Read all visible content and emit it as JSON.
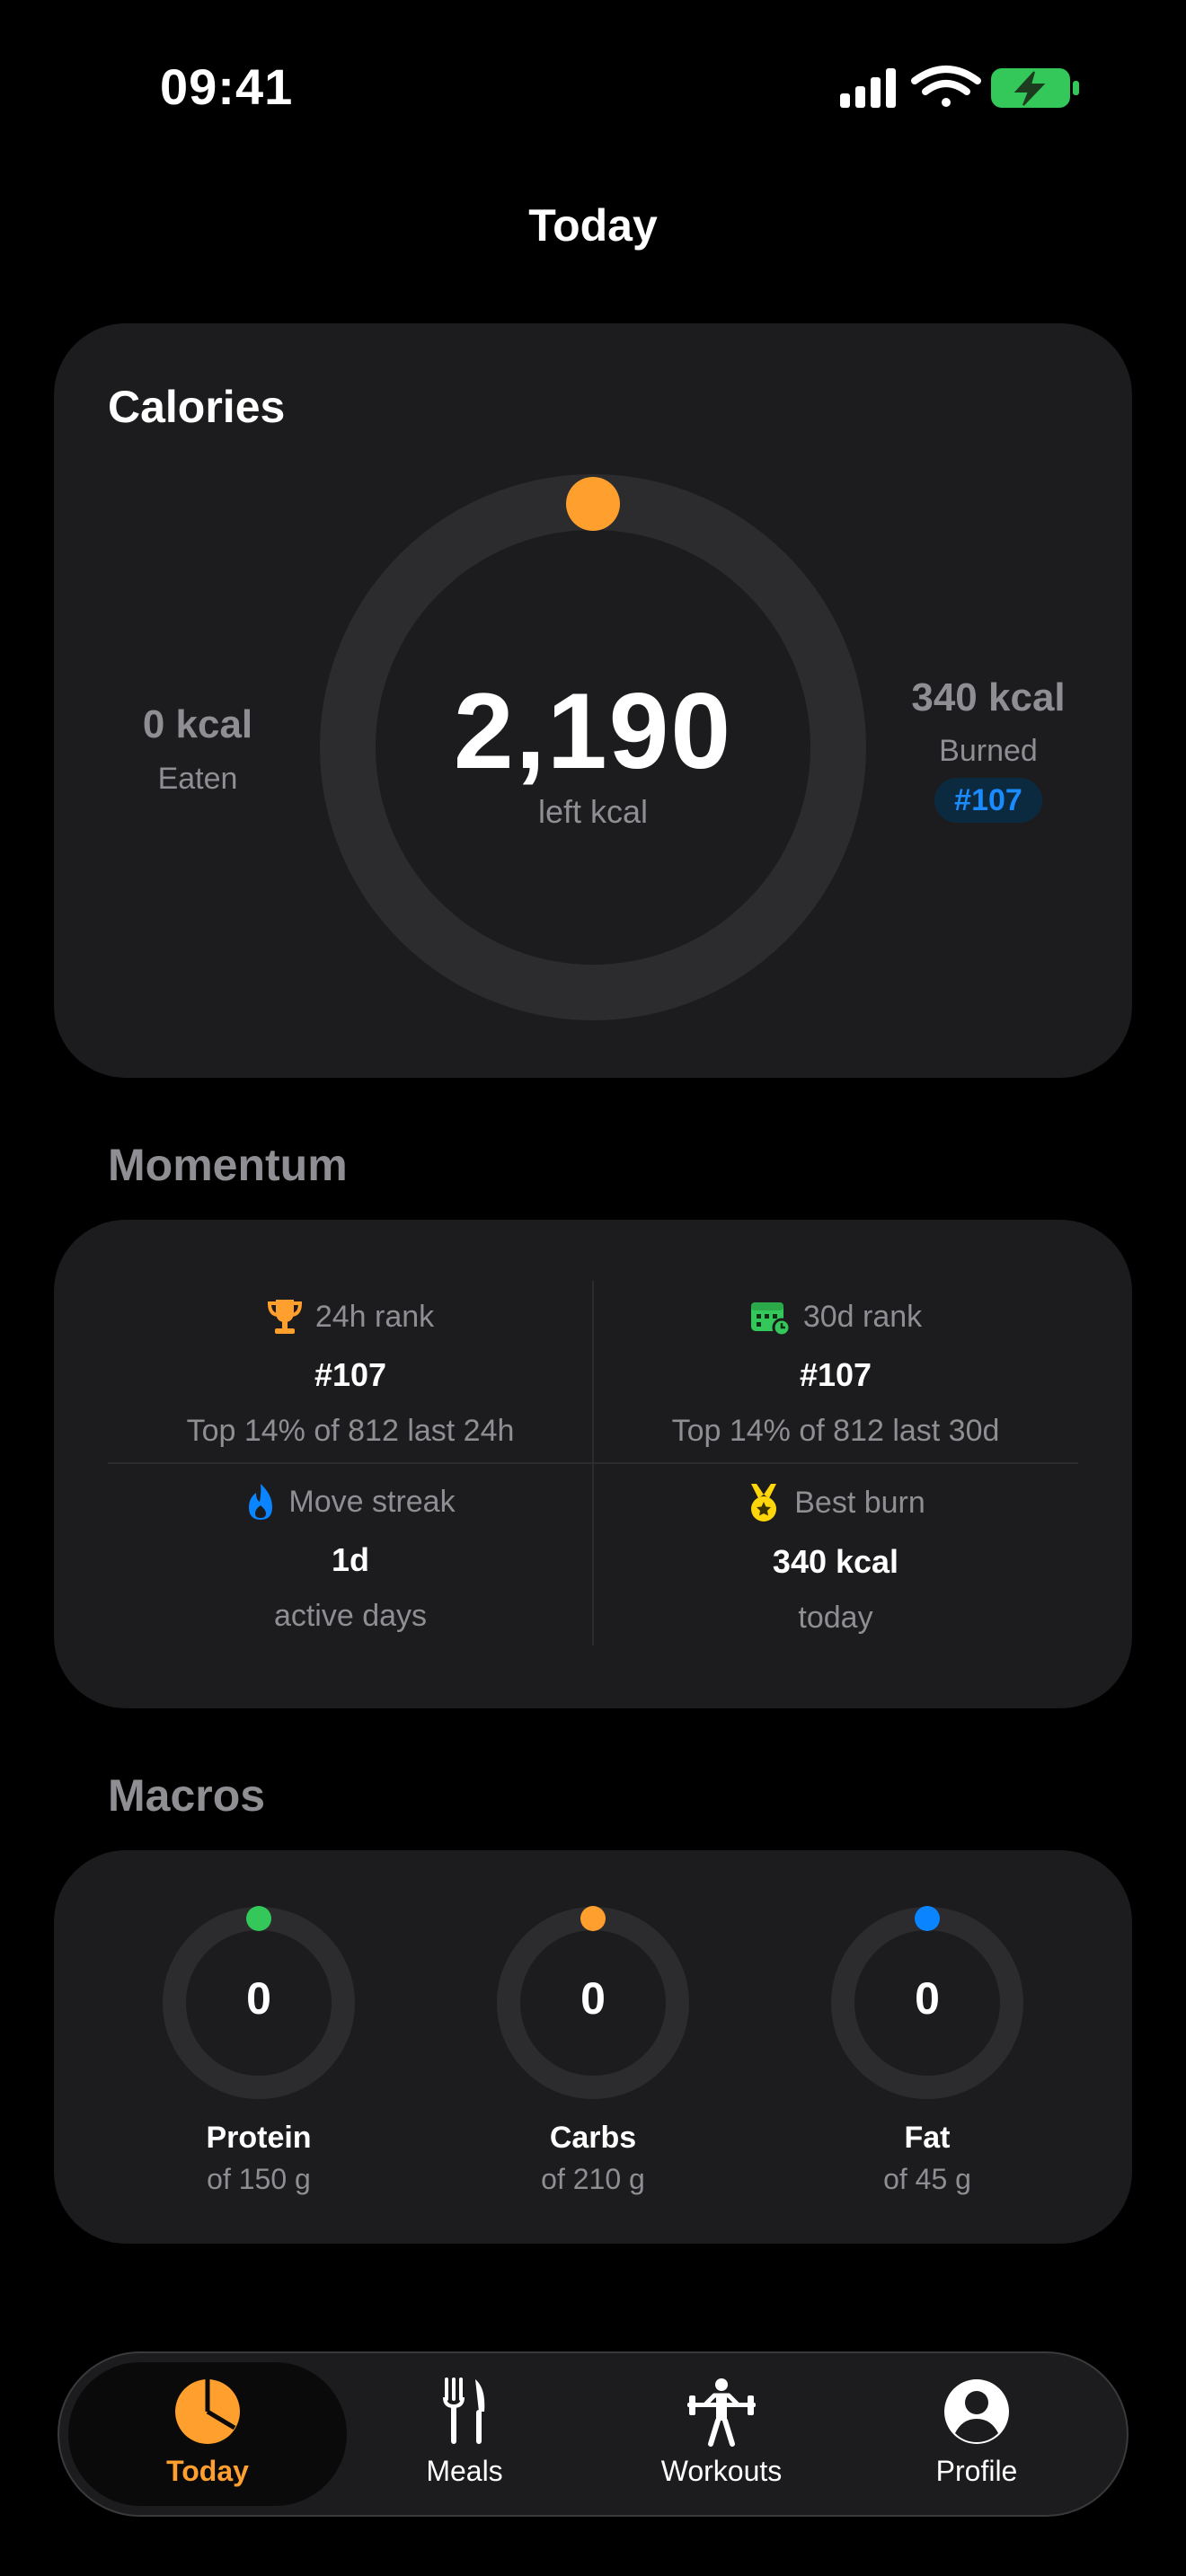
{
  "status_bar": {
    "time": "09:41"
  },
  "header": {
    "title": "Today"
  },
  "calories": {
    "title": "Calories",
    "remaining": "2,190",
    "remaining_label": "left kcal",
    "eaten_value": "0 kcal",
    "eaten_label": "Eaten",
    "burned_value": "340 kcal",
    "burned_label": "Burned",
    "rank_badge": "#107",
    "progress": 0
  },
  "momentum": {
    "title": "Momentum",
    "cells": [
      {
        "label": "24h rank",
        "icon": "trophy-icon",
        "value": "#107",
        "sub": "Top 14% of 812 last 24h"
      },
      {
        "label": "30d rank",
        "icon": "calendar-icon",
        "value": "#107",
        "sub": "Top 14% of 812 last 30d"
      },
      {
        "label": "Move streak",
        "icon": "flame-icon",
        "value": "1d",
        "sub": "active days"
      },
      {
        "label": "Best burn",
        "icon": "medal-icon",
        "value": "340 kcal",
        "sub": "today"
      }
    ]
  },
  "macros": {
    "title": "Macros",
    "items": [
      {
        "name": "Protein",
        "value": "0",
        "goal": "of 150 g",
        "color": "#34c759"
      },
      {
        "name": "Carbs",
        "value": "0",
        "goal": "of 210 g",
        "color": "#ff9f2e"
      },
      {
        "name": "Fat",
        "value": "0",
        "goal": "of 45 g",
        "color": "#0a84ff"
      }
    ]
  },
  "tabbar": {
    "items": [
      {
        "label": "Today",
        "icon": "pie-chart-icon",
        "active": true
      },
      {
        "label": "Meals",
        "icon": "fork-knife-icon",
        "active": false
      },
      {
        "label": "Workouts",
        "icon": "weightlifter-icon",
        "active": false
      },
      {
        "label": "Profile",
        "icon": "person-circle-icon",
        "active": false
      }
    ]
  },
  "colors": {
    "accent": "#ff9f2e",
    "background": "#000000",
    "card": "#1c1c1e",
    "muted_text": "#8e8e93",
    "rank_blue": "#1a8cff",
    "battery_green": "#34c759"
  }
}
